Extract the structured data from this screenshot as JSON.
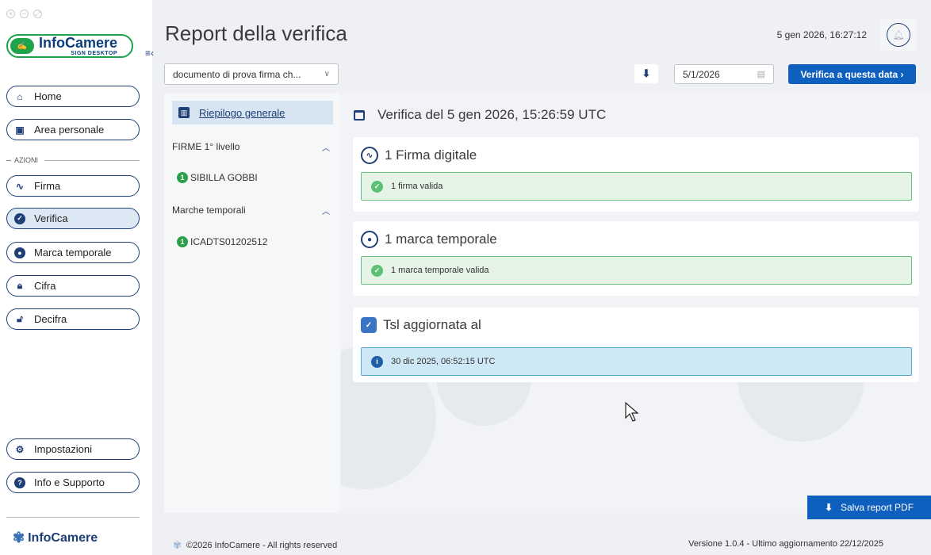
{
  "window": {
    "controls": [
      "close",
      "minimize",
      "maximize"
    ]
  },
  "sidebar": {
    "logo": {
      "name": "InfoCamere",
      "subtitle": "SIGN DESKTOP"
    },
    "top_items": [
      {
        "label": "Home",
        "icon": "home-icon"
      },
      {
        "label": "Area personale",
        "icon": "id-card-icon"
      }
    ],
    "section_label": "AZIONI",
    "action_items": [
      {
        "label": "Firma",
        "icon": "signature-icon"
      },
      {
        "label": "Verifica",
        "icon": "badge-check-icon",
        "active": true
      },
      {
        "label": "Marca temporale",
        "icon": "timestamp-icon"
      },
      {
        "label": "Cifra",
        "icon": "lock-icon"
      },
      {
        "label": "Decifra",
        "icon": "unlock-icon"
      }
    ],
    "bottom_items": [
      {
        "label": "Impostazioni",
        "icon": "gear-icon"
      },
      {
        "label": "Info e Supporto",
        "icon": "help-icon"
      }
    ],
    "footer_brand": "InfoCamere"
  },
  "header": {
    "title": "Report della verifica",
    "datetime": "5 gen 2026, 16:27:12"
  },
  "toolbar": {
    "document_select": "documento di prova firma ch...",
    "date_value": "5/1/2026",
    "verify_button": "Verifica a questa data"
  },
  "tree": {
    "summary_label": "Riepilogo generale",
    "groups": [
      {
        "title": "FIRME 1° livello",
        "items": [
          {
            "count": "1",
            "label": "SIBILLA GOBBI"
          }
        ]
      },
      {
        "title": "Marche temporali",
        "items": [
          {
            "count": "1",
            "label": "ICADTS01202512"
          }
        ]
      }
    ]
  },
  "report": {
    "heading": "Verifica del 5 gen 2026, 15:26:59 UTC",
    "cards": [
      {
        "title": "1 Firma digitale",
        "status": "1 firma valida",
        "kind": "ok"
      },
      {
        "title": "1 marca temporale",
        "status": "1 marca temporale valida",
        "kind": "ok"
      },
      {
        "title": "Tsl aggiornata al",
        "status": "30 dic 2025, 06:52:15 UTC",
        "kind": "info"
      }
    ]
  },
  "save_button": "Salva report PDF",
  "footer": {
    "copyright": "©2026 InfoCamere - All rights reserved",
    "version": "Versione 1.0.4 - Ultimo aggiornamento 22/12/2025"
  },
  "colors": {
    "primary": "#0f5fbf",
    "navy": "#1e3f77",
    "brand_green": "#1ea34a",
    "success": "#5cc174",
    "info_bg": "#cfe8f5"
  }
}
